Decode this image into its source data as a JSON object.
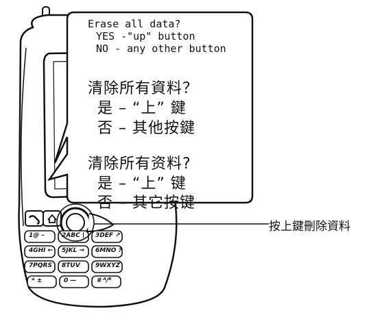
{
  "callout": {
    "en_line1": "Erase all data?",
    "en_line2": "YES -\"up\" button",
    "en_line3": "NO - any other button",
    "trad_line1": "清除所有資料？",
    "trad_line2": "是 – “上” 鍵",
    "trad_line3": "否 – 其他按鍵",
    "simp_line1": "清除所有资料?",
    "simp_line2": "是 – “上” 键",
    "simp_line3": "否 – 其它按键"
  },
  "annotation": {
    "label": "按上鍵刪除資料"
  },
  "keypad": {
    "keys": [
      "1@ –",
      "2ABC |",
      "3DEF ↗",
      "4GHI ←",
      "5JKL →",
      "6MNO ?",
      "7PQRS",
      "8TUV",
      "9WXYZ",
      "* ±",
      "0 —",
      "# ᴬ/ᴿ"
    ]
  },
  "icons": {
    "call": "phone-handset-icon",
    "home": "home-icon",
    "up": "up-nav-button"
  }
}
